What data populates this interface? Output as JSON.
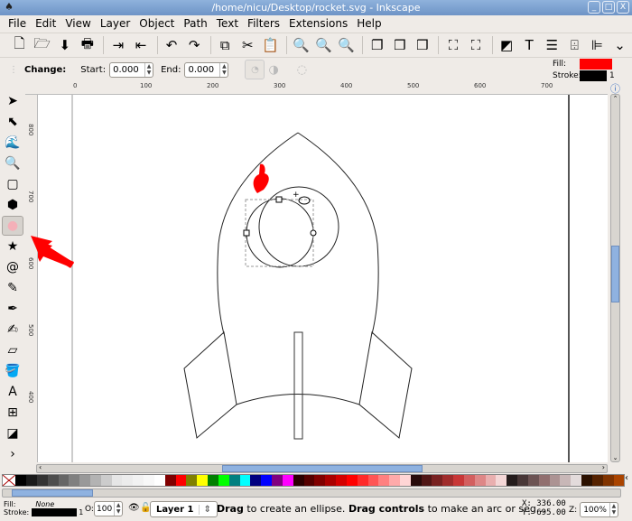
{
  "window": {
    "title": "/home/nicu/Desktop/rocket.svg - Inkscape",
    "controls": [
      "_",
      "□",
      "X"
    ]
  },
  "menu": [
    "File",
    "Edit",
    "View",
    "Layer",
    "Object",
    "Path",
    "Text",
    "Filters",
    "Extensions",
    "Help"
  ],
  "toolbar": {
    "icons": [
      "new-icon",
      "open-icon",
      "save-icon",
      "print-icon",
      "sep",
      "import-icon",
      "export-icon",
      "sep",
      "undo-icon",
      "redo-icon",
      "sep",
      "copy-icon",
      "cut-icon",
      "paste-icon",
      "sep",
      "zoom-selection-icon",
      "zoom-drawing-icon",
      "zoom-page-icon",
      "sep",
      "duplicate-icon",
      "clone-icon",
      "unlink-clone-icon",
      "sep",
      "group-icon",
      "ungroup-icon",
      "sep",
      "fill-stroke-icon",
      "text-font-icon",
      "layers-icon",
      "xml-editor-icon",
      "align-icon",
      "more-icon"
    ],
    "glyphs": [
      "🗋",
      "🗁",
      "⬇",
      "🖶",
      "",
      "⇥",
      "⇤",
      "",
      "↶",
      "↷",
      "",
      "⧉",
      "✂",
      "📋",
      "",
      "🔍",
      "🔍",
      "🔍",
      "",
      "❐",
      "❒",
      "❒",
      "",
      "⛶",
      "⛶",
      "",
      "◩",
      "T",
      "☰",
      "⌹",
      "⊫",
      "⌄"
    ]
  },
  "controls": {
    "change_label": "Change:",
    "start_label": "Start:",
    "start_value": "0.000",
    "end_label": "End:",
    "end_value": "0.000"
  },
  "style_indicator": {
    "fill_label": "Fill:",
    "fill_color": "#ff0000",
    "stroke_label": "Stroke:",
    "stroke_color": "#000000",
    "stroke_width": "1"
  },
  "ruler": {
    "h_labels": [
      "0",
      "100",
      "200",
      "300",
      "400",
      "500",
      "600",
      "700"
    ],
    "v_labels": [
      "800",
      "700",
      "600",
      "500",
      "400"
    ]
  },
  "tools": [
    {
      "name": "selector-tool",
      "glyph": "➤"
    },
    {
      "name": "node-tool",
      "glyph": "⬉"
    },
    {
      "name": "tweak-tool",
      "glyph": "🌊"
    },
    {
      "name": "zoom-tool",
      "glyph": "🔍"
    },
    {
      "name": "rectangle-tool",
      "glyph": "▢"
    },
    {
      "name": "3d-box-tool",
      "glyph": "⬢"
    },
    {
      "name": "ellipse-tool",
      "glyph": "●",
      "active": true
    },
    {
      "name": "star-tool",
      "glyph": "★"
    },
    {
      "name": "spiral-tool",
      "glyph": "@"
    },
    {
      "name": "pencil-tool",
      "glyph": "✎"
    },
    {
      "name": "pen-tool",
      "glyph": "✒"
    },
    {
      "name": "calligraphy-tool",
      "glyph": "✍"
    },
    {
      "name": "eraser-tool",
      "glyph": "▱"
    },
    {
      "name": "paint-bucket-tool",
      "glyph": "🪣"
    },
    {
      "name": "text-tool",
      "glyph": "A"
    },
    {
      "name": "connector-tool",
      "glyph": "⊞"
    },
    {
      "name": "gradient-tool",
      "glyph": "◪"
    },
    {
      "name": "more-tools",
      "glyph": "›"
    }
  ],
  "palette": [
    "#000000",
    "#1a1a1a",
    "#333333",
    "#4d4d4d",
    "#666666",
    "#808080",
    "#999999",
    "#b3b3b3",
    "#cccccc",
    "#e6e6e6",
    "#ececec",
    "#f2f2f2",
    "#f8f8f8",
    "#ffffff",
    "#800000",
    "#ff0000",
    "#808000",
    "#ffff00",
    "#008000",
    "#00ff00",
    "#008080",
    "#00ffff",
    "#000080",
    "#0000ff",
    "#800080",
    "#ff00ff",
    "#2b0000",
    "#550000",
    "#800000",
    "#aa0000",
    "#d40000",
    "#ff0000",
    "#ff2a2a",
    "#ff5555",
    "#ff8080",
    "#ffaaaa",
    "#ffd5d5",
    "#280b0b",
    "#501616",
    "#782121",
    "#a02c2c",
    "#c83737",
    "#d35f5f",
    "#de8787",
    "#e9afaf",
    "#f4d7d7",
    "#241c1c",
    "#483737",
    "#6c5353",
    "#916f6f",
    "#ac9393",
    "#c8b7b7",
    "#e3dbdb",
    "#2b1100",
    "#552200",
    "#803300",
    "#aa4400"
  ],
  "status": {
    "fill_label": "Fill:",
    "fill_value": "None",
    "stroke_label": "Stroke:",
    "stroke_width": "1",
    "opacity_label": "O:",
    "opacity_value": "100",
    "layer": "Layer 1",
    "msg_b1": "Drag",
    "msg_t1": " to create an ellipse. ",
    "msg_b2": "Drag controls",
    "msg_t2": " to make an arc or seg...",
    "x_label": "X:",
    "x_value": "336.00",
    "y_label": "Y:",
    "y_value": "695.00",
    "zoom_label": "Z:",
    "zoom_value": "100%"
  }
}
